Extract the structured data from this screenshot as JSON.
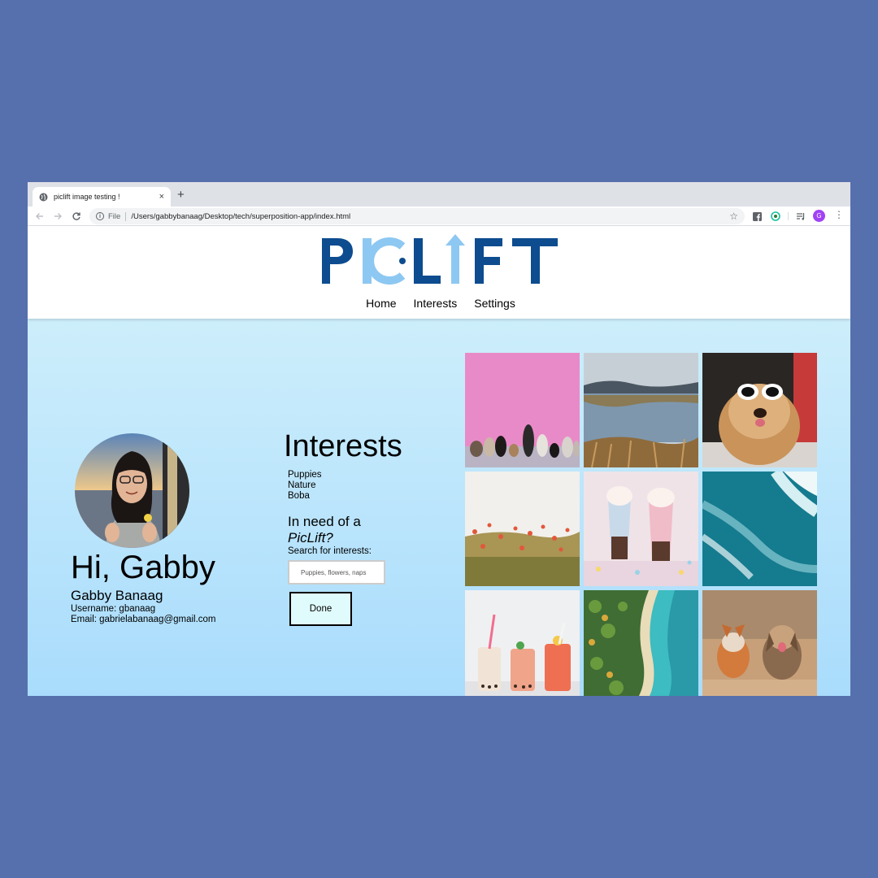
{
  "browser": {
    "tab_title": "piclift image testing !",
    "tab_close": "×",
    "new_tab": "+",
    "scheme_label": "File",
    "url": "/Users/gabbybanaag/Desktop/tech/superposition-app/index.html",
    "profile_initial": "G"
  },
  "site": {
    "logo_text": "PICLIFT",
    "nav": [
      "Home",
      "Interests",
      "Settings"
    ]
  },
  "profile": {
    "greeting": "Hi, Gabby",
    "full_name": "Gabby Banaag",
    "username": "Username: gbanaag",
    "email": "Email: gabrielabanaag@gmail.com"
  },
  "interests": {
    "title": "Interests",
    "items": [
      "Puppies",
      "Nature",
      "Boba"
    ],
    "need_line1": "In need of a",
    "need_brand": "PicLift?",
    "search_label": "Search for interests:",
    "search_placeholder": "Puppies, flowers, naps",
    "done_label": "Done"
  },
  "gallery": {
    "tiles": [
      "dogs-pink-wall-photo",
      "lake-landscape-photo",
      "dog-sunglasses-photo",
      "poppy-field-photo",
      "milkshakes-photo",
      "ocean-waves-photo",
      "boba-drinks-photo",
      "aerial-coast-photo",
      "running-dogs-photo"
    ]
  },
  "colors": {
    "background": "#5670ad",
    "logo_dark": "#0d4c8f",
    "logo_light": "#8dc8f2",
    "content_top": "#cdeefb",
    "content_bottom": "#a9dcfc",
    "button_fill": "#e0fbfc"
  }
}
